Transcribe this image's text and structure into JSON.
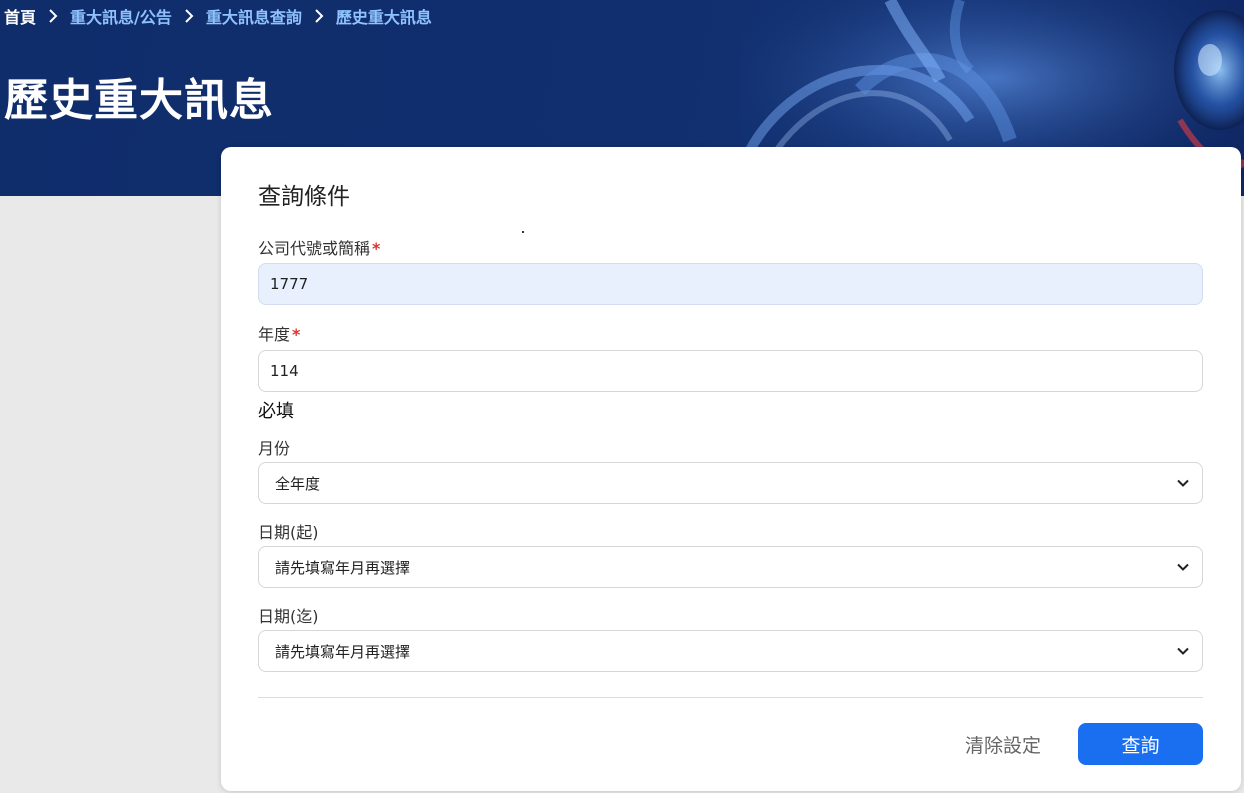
{
  "breadcrumb": {
    "home": "首頁",
    "level1": "重大訊息/公告",
    "level2": "重大訊息查詢",
    "current": "歷史重大訊息"
  },
  "page_title": "歷史重大訊息",
  "form": {
    "title": "查詢條件",
    "company": {
      "label": "公司代號或簡稱",
      "required_mark": "*",
      "value": "1777"
    },
    "year": {
      "label": "年度",
      "required_mark": "*",
      "value": "114",
      "hint": "必填"
    },
    "month": {
      "label": "月份",
      "selected": "全年度"
    },
    "date_from": {
      "label": "日期(起)",
      "selected": "請先填寫年月再選擇"
    },
    "date_to": {
      "label": "日期(迄)",
      "selected": "請先填寫年月再選擇"
    }
  },
  "actions": {
    "clear_label": "清除設定",
    "search_label": "查詢"
  },
  "colors": {
    "header_bg": "#0f2c6b",
    "accent": "#1a6ff0",
    "required": "#e03131",
    "filled_input": "#e8f0fe"
  }
}
